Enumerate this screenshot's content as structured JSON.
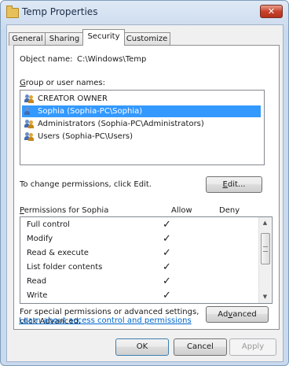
{
  "window": {
    "title": "Temp Properties",
    "close_label": "✕"
  },
  "tabs": [
    "General",
    "Sharing",
    "Security",
    "Customize"
  ],
  "security": {
    "object_name_label": "Object name:",
    "object_name_value": "C:\\Windows\\Temp",
    "group_label_prefix": "",
    "group_label_accel": "G",
    "group_label_rest": "roup or user names:",
    "users": [
      {
        "name": "CREATOR OWNER",
        "selected": false
      },
      {
        "name": "Sophia (Sophia-PC\\Sophia)",
        "selected": true
      },
      {
        "name": "Administrators (Sophia-PC\\Administrators)",
        "selected": false
      },
      {
        "name": "Users (Sophia-PC\\Users)",
        "selected": false
      }
    ],
    "change_text": "To change permissions, click Edit.",
    "edit_button_accel": "E",
    "edit_button_rest": "dit...",
    "permissions_label_accel": "P",
    "permissions_label_rest": "ermissions for Sophia",
    "allow_header": "Allow",
    "deny_header": "Deny",
    "permissions": [
      {
        "name": "Full control",
        "allow": "✓",
        "deny": ""
      },
      {
        "name": "Modify",
        "allow": "✓",
        "deny": ""
      },
      {
        "name": "Read & execute",
        "allow": "✓",
        "deny": ""
      },
      {
        "name": "List folder contents",
        "allow": "✓",
        "deny": ""
      },
      {
        "name": "Read",
        "allow": "✓",
        "deny": ""
      },
      {
        "name": "Write",
        "allow": "✓",
        "deny": ""
      }
    ],
    "special_text_line1": "For special permissions or advanced settings,",
    "special_text_line2": "click Advanced.",
    "advanced_button_pre": "Ad",
    "advanced_button_accel": "v",
    "advanced_button_rest": "anced",
    "learn_link": "Learn about access control and permissions"
  },
  "footer": {
    "ok_label": "OK",
    "cancel_label": "Cancel",
    "apply_label": "Apply"
  },
  "colors": {
    "selection": "#3399ff",
    "link": "#0066cc",
    "close": "#c7422c"
  }
}
